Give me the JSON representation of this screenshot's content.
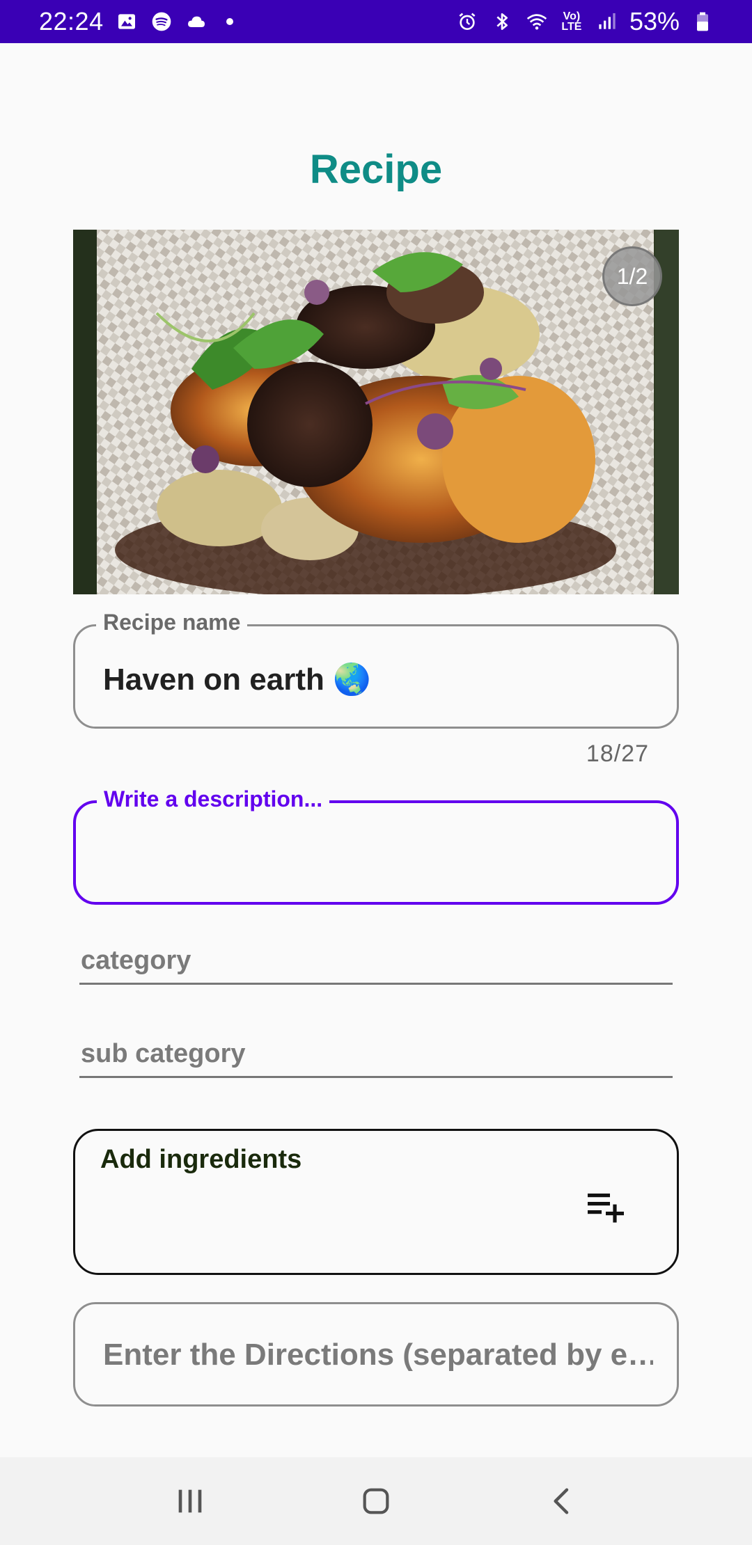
{
  "status_bar": {
    "time": "22:24",
    "battery_percent": "53%",
    "volte_label": "Vo)\nLTE",
    "left_icons": [
      "image-icon",
      "spotify-icon",
      "cloud-icon"
    ],
    "right_icons": [
      "alarm-icon",
      "bluetooth-icon",
      "wifi-icon",
      "volte-icon",
      "signal-icon",
      "battery-icon"
    ],
    "background_color": "#3a00b5"
  },
  "page": {
    "title": "Recipe",
    "title_color": "#0f8c86"
  },
  "photo": {
    "counter": "1/2"
  },
  "form": {
    "recipe_name": {
      "label": "Recipe name",
      "value": "Haven on earth 🌏",
      "counter": "18/27"
    },
    "description": {
      "label": "Write a description...",
      "value": "",
      "focused": true,
      "accent_color": "#6200ee"
    },
    "category": {
      "placeholder": "category"
    },
    "sub_category": {
      "placeholder": "sub category"
    },
    "ingredients": {
      "title": "Add ingredients",
      "add_icon": "playlist-add-icon"
    },
    "directions": {
      "placeholder": "Enter the Directions (separated by e…"
    }
  },
  "nav_bar": {
    "buttons": [
      "recents-icon",
      "home-icon",
      "back-icon"
    ]
  }
}
